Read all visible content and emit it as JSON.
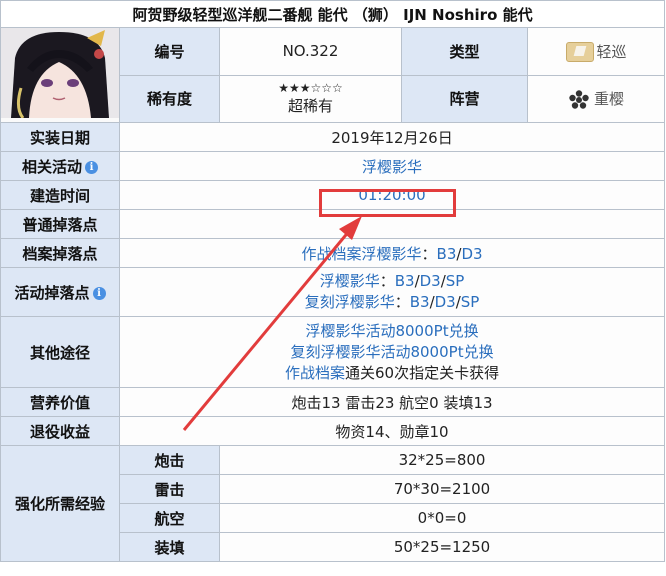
{
  "title": "阿贺野级轻型巡洋舰二番舰 能代 （狮） IJN Noshiro 能代",
  "labels": {
    "number": "编号",
    "type": "类型",
    "rarity": "稀有度",
    "faction": "阵营",
    "impl_date": "实装日期",
    "related_event": "相关活动",
    "build_time": "建造时间",
    "normal_drop": "普通掉落点",
    "archive_drop": "档案掉落点",
    "event_drop": "活动掉落点",
    "other_ways": "其他途径",
    "nutrition": "营养价值",
    "retire": "退役收益",
    "enhance_exp": "强化所需经验"
  },
  "values": {
    "number": "NO.322",
    "type": "轻巡",
    "stars": "★★★☆☆☆",
    "rarity": "超稀有",
    "faction": "重樱",
    "impl_date": "2019年12月26日",
    "related_event": "浮樱影华",
    "build_time": "01:20:00",
    "normal_drop": "",
    "archive_drop": {
      "link": "作战档案浮樱影华",
      "sep": "：",
      "b3": "B3",
      "slash": "/",
      "d3": "D3"
    },
    "event_drop": [
      {
        "name": "浮樱影华",
        "sep": "：",
        "b3": "B3",
        "s1": "/",
        "d3": "D3",
        "s2": "/",
        "sp": "SP"
      },
      {
        "name": "复刻浮樱影华",
        "sep": "：",
        "b3": "B3",
        "s1": "/",
        "d3": "D3",
        "s2": "/",
        "sp": "SP"
      }
    ],
    "other_ways": {
      "line1": "浮樱影华活动8000Pt兑换",
      "line2": "复刻浮樱影华活动8000Pt兑换",
      "line3_link": "作战档案",
      "line3_text": "通关60次指定关卡获得"
    },
    "nutrition": "炮击13 雷击23 航空0 装填13",
    "retire": "物资14、勋章10"
  },
  "enhance": [
    {
      "stat": "炮击",
      "formula": "32*25=800"
    },
    {
      "stat": "雷击",
      "formula": "70*30=2100"
    },
    {
      "stat": "航空",
      "formula": "0*0=0"
    },
    {
      "stat": "装填",
      "formula": "50*25=1250"
    }
  ],
  "info_icon_glyph": "i",
  "colors": {
    "label_bg": "#dde7f5",
    "link": "#2a6ebd",
    "highlight": "#e23c3c"
  }
}
